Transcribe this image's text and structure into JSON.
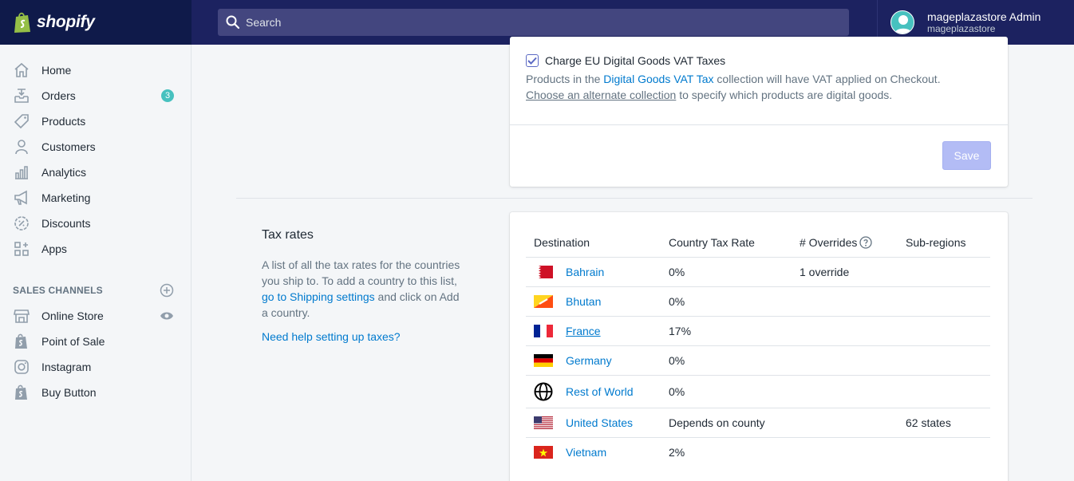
{
  "brand": {
    "name": "shopify"
  },
  "search": {
    "placeholder": "Search"
  },
  "account": {
    "name": "mageplazastore Admin",
    "store": "mageplazastore"
  },
  "sidebar": {
    "items": [
      {
        "label": "Home",
        "icon": "home-icon"
      },
      {
        "label": "Orders",
        "icon": "orders-icon",
        "badge": "3"
      },
      {
        "label": "Products",
        "icon": "tag-icon"
      },
      {
        "label": "Customers",
        "icon": "person-icon"
      },
      {
        "label": "Analytics",
        "icon": "bar-chart-icon"
      },
      {
        "label": "Marketing",
        "icon": "megaphone-icon"
      },
      {
        "label": "Discounts",
        "icon": "discount-icon"
      },
      {
        "label": "Apps",
        "icon": "apps-icon"
      }
    ],
    "sales_channels_title": "SALES CHANNELS",
    "channels": [
      {
        "label": "Online Store",
        "icon": "store-icon"
      },
      {
        "label": "Point of Sale",
        "icon": "shopify-bag-icon"
      },
      {
        "label": "Instagram",
        "icon": "instagram-icon"
      },
      {
        "label": "Buy Button",
        "icon": "shopify-bag-icon"
      }
    ]
  },
  "vat": {
    "checkbox_label": "Charge EU Digital Goods VAT Taxes",
    "checked": true,
    "help_prefix": "Products in the ",
    "help_link": "Digital Goods VAT Tax",
    "help_suffix": " collection will have VAT applied on Checkout.",
    "alt_link": "Choose an alternate collection",
    "alt_suffix": " to specify which products are digital goods.",
    "save_label": "Save"
  },
  "tax_rates": {
    "title": "Tax rates",
    "desc_1": "A list of all the tax rates for the countries you ship to. To add a country to this list, ",
    "desc_link": "go to Shipping settings",
    "desc_2": " and click on Add a country.",
    "help_link": "Need help setting up taxes?",
    "columns": [
      "Destination",
      "Country Tax Rate",
      "# Overrides",
      "Sub-regions"
    ],
    "rows": [
      {
        "destination": "Bahrain",
        "rate": "0%",
        "overrides": "1 override",
        "subregions": ""
      },
      {
        "destination": "Bhutan",
        "rate": "0%",
        "overrides": "",
        "subregions": ""
      },
      {
        "destination": "France",
        "rate": "17%",
        "overrides": "",
        "subregions": ""
      },
      {
        "destination": "Germany",
        "rate": "0%",
        "overrides": "",
        "subregions": ""
      },
      {
        "destination": "Rest of World",
        "rate": "0%",
        "overrides": "",
        "subregions": ""
      },
      {
        "destination": "United States",
        "rate": "Depends on county",
        "overrides": "",
        "subregions": "62 states"
      },
      {
        "destination": "Vietnam",
        "rate": "2%",
        "overrides": "",
        "subregions": ""
      }
    ]
  },
  "colors": {
    "topbar": "#1c2260",
    "accent": "#5c6ac4",
    "link": "#007ace",
    "badge": "#47c1bf"
  }
}
